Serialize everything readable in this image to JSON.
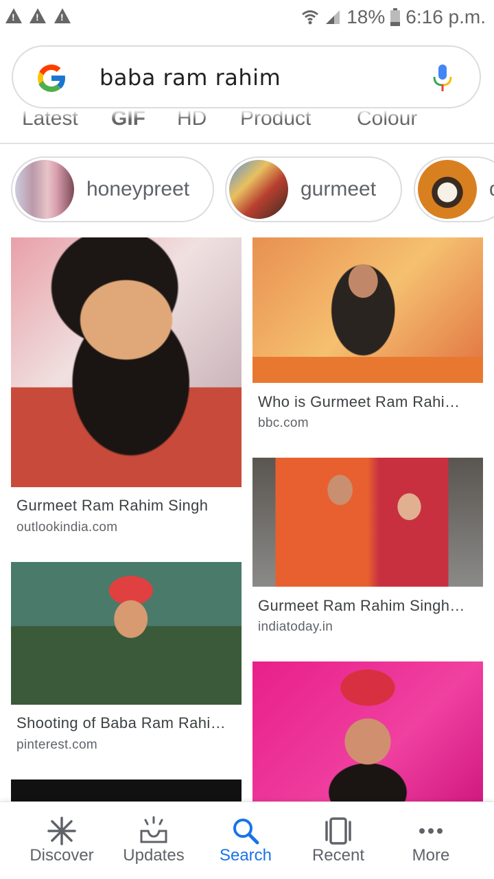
{
  "status_bar": {
    "battery": "18%",
    "time": "6:16 p.m."
  },
  "search": {
    "query": "baba ram rahim"
  },
  "filters": [
    "Latest",
    "GIF",
    "HD",
    "Product",
    "Colour"
  ],
  "chips": [
    {
      "label": "honeypreet"
    },
    {
      "label": "gurmeet"
    },
    {
      "label": "d"
    }
  ],
  "results": [
    {
      "title": "Gurmeet Ram Rahim Singh",
      "source": "outlookindia.com"
    },
    {
      "title": "Who is Gurmeet Ram Rahi…",
      "source": "bbc.com"
    },
    {
      "title": "Gurmeet Ram Rahim Singh…",
      "source": "indiatoday.in"
    },
    {
      "title": "Shooting of Baba Ram Rahi…",
      "source": "pinterest.com"
    }
  ],
  "bottom_nav": [
    {
      "label": "Discover",
      "icon": "asterisk-icon"
    },
    {
      "label": "Updates",
      "icon": "tray-icon"
    },
    {
      "label": "Search",
      "icon": "search-icon",
      "active": true
    },
    {
      "label": "Recent",
      "icon": "recent-tabs-icon"
    },
    {
      "label": "More",
      "icon": "more-dots-icon"
    }
  ],
  "colors": {
    "accent": "#1a73e8",
    "text_secondary": "#5f6368",
    "chip_border": "#dadce0"
  }
}
